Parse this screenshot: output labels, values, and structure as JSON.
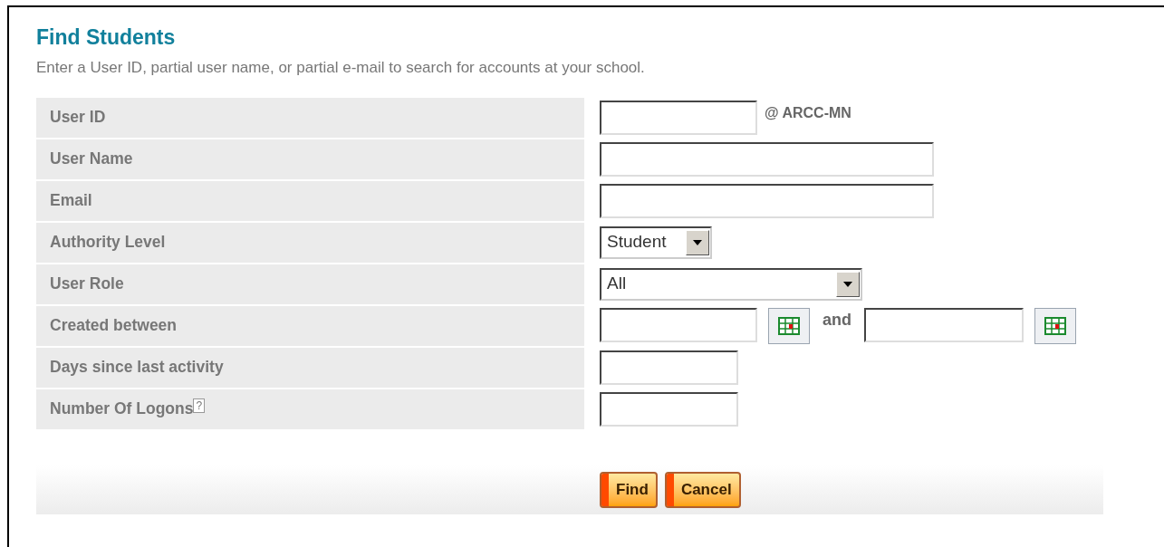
{
  "title": "Find Students",
  "instructions": "Enter a User ID, partial user name, or partial e-mail to search for accounts at your school.",
  "fields": [
    {
      "label": "User ID",
      "kind": "text",
      "suffix": "@ ARCC-MN"
    },
    {
      "label": "User Name",
      "kind": "wide_text"
    },
    {
      "label": "Email",
      "kind": "wide_text"
    },
    {
      "label": "Authority Level",
      "kind": "select",
      "value": "Student"
    },
    {
      "label": "User Role",
      "kind": "wide_select",
      "value": "All"
    },
    {
      "label": "Created between",
      "kind": "date_range",
      "joiner": "and"
    },
    {
      "label": "Days since last activity",
      "kind": "short_text"
    },
    {
      "label": "Number Of Logons",
      "kind": "short_text",
      "help_mark": "?"
    }
  ],
  "buttons": [
    "Find",
    "Cancel"
  ]
}
